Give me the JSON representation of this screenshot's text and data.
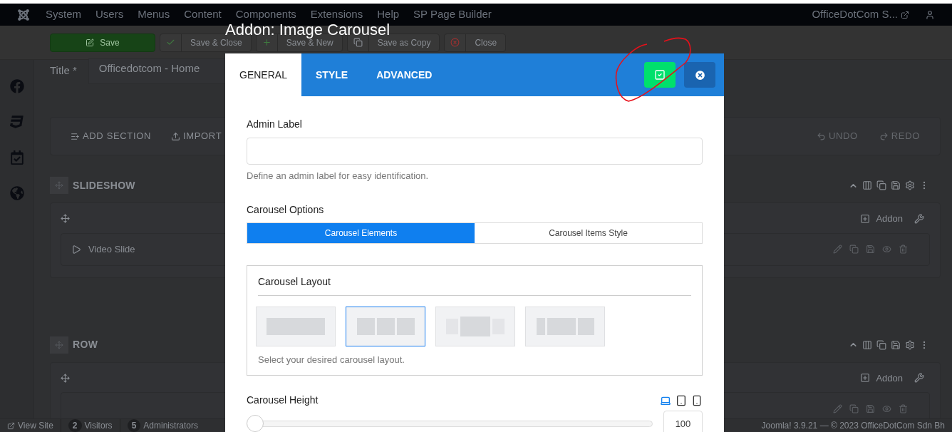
{
  "topbar": {
    "menu": [
      "System",
      "Users",
      "Menus",
      "Content",
      "Components",
      "Extensions",
      "Help",
      "SP Page Builder"
    ],
    "site_link": "OfficeDotCom S..."
  },
  "toolbar": {
    "buttons": [
      {
        "label": "Save",
        "kind": "primary"
      },
      {
        "label": "Save & Close",
        "kind": "check"
      },
      {
        "label": "Save & New",
        "kind": "plus"
      },
      {
        "label": "Save as Copy",
        "kind": "copy"
      },
      {
        "label": "Close",
        "kind": "close"
      }
    ]
  },
  "title_field": {
    "label": "Title *",
    "value": "Officedotcom - Home"
  },
  "builder_toolbar": {
    "left": [
      {
        "label": "ADD SECTION",
        "kind": "add"
      },
      {
        "label": "IMPORT",
        "kind": "import"
      }
    ],
    "right": [
      {
        "label": "UNDO",
        "kind": "undo"
      },
      {
        "label": "REDO",
        "kind": "redo"
      }
    ]
  },
  "sections": [
    {
      "title": "SLIDESHOW",
      "addon_label": "Addon",
      "item": "Video Slide"
    },
    {
      "title": "ROW",
      "addon_label": "Addon"
    }
  ],
  "status_bar": {
    "view_site": "View Site",
    "counters": [
      {
        "count": "2",
        "label": "Visitors"
      },
      {
        "count": "5",
        "label": "Administrators"
      }
    ],
    "version": "Joomla! 3.9.21 — © 2023 OfficeDotCom Sdn Bh"
  },
  "modal": {
    "title": "Addon: Image Carousel",
    "tabs": [
      {
        "label": "GENERAL",
        "selected": true
      },
      {
        "label": "STYLE",
        "selected": false
      },
      {
        "label": "ADVANCED",
        "selected": false
      }
    ],
    "admin_label": {
      "label": "Admin Label",
      "help": "Define an admin label for easy identification."
    },
    "carousel_options": {
      "label": "Carousel Options",
      "tabs": [
        {
          "label": "Carousel Elements",
          "selected": true
        },
        {
          "label": "Carousel Items Style",
          "selected": false
        }
      ]
    },
    "carousel_layout": {
      "label": "Carousel Layout",
      "options": [
        {
          "kind": "single",
          "selected": false
        },
        {
          "kind": "three",
          "selected": true
        },
        {
          "kind": "center",
          "selected": false
        },
        {
          "kind": "offset",
          "selected": false
        }
      ],
      "help": "Select your desired carousel layout."
    },
    "carousel_height": {
      "label": "Carousel Height",
      "devices": [
        {
          "kind": "desktop",
          "selected": true
        },
        {
          "kind": "tablet",
          "selected": false
        },
        {
          "kind": "mobile",
          "selected": false
        }
      ],
      "level": 0,
      "value": "100"
    }
  }
}
